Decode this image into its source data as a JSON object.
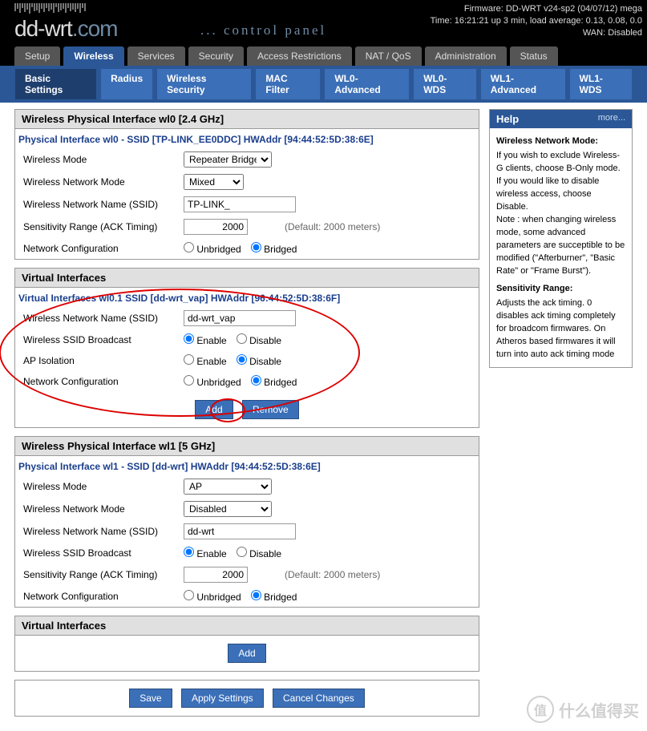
{
  "header": {
    "logo_main": "dd-wrt",
    "logo_suffix": ".com",
    "control_panel": "... control panel",
    "firmware": "Firmware: DD-WRT v24-sp2 (04/07/12) mega",
    "time": "Time: 16:21:21 up 3 min, load average: 0.13, 0.08, 0.0",
    "wan": "WAN: Disabled"
  },
  "tabs": [
    "Setup",
    "Wireless",
    "Services",
    "Security",
    "Access Restrictions",
    "NAT / QoS",
    "Administration",
    "Status"
  ],
  "active_tab": 1,
  "subtabs": [
    "Basic Settings",
    "Radius",
    "Wireless Security",
    "MAC Filter",
    "WL0-Advanced",
    "WL0-WDS",
    "WL1-Advanced",
    "WL1-WDS"
  ],
  "active_subtab": 0,
  "wl0": {
    "legend": "Wireless Physical Interface wl0 [2.4 GHz]",
    "title": "Physical Interface wl0 - SSID [TP-LINK_EE0DDC] HWAddr [94:44:52:5D:38:6E]",
    "labels": {
      "mode": "Wireless Mode",
      "netmode": "Wireless Network Mode",
      "ssid": "Wireless Network Name (SSID)",
      "sens": "Sensitivity Range (ACK Timing)",
      "netcfg": "Network Configuration"
    },
    "mode_val": "Repeater Bridge",
    "netmode_val": "Mixed",
    "ssid_val": "TP-LINK_",
    "sens_val": "2000",
    "sens_default": "(Default: 2000 meters)",
    "unbridged": "Unbridged",
    "bridged": "Bridged"
  },
  "vif0": {
    "legend": "Virtual Interfaces",
    "title": "Virtual Interfaces wl0.1 SSID [dd-wrt_vap] HWAddr [96:44:52:5D:38:6F]",
    "labels": {
      "ssid": "Wireless Network Name (SSID)",
      "broadcast": "Wireless SSID Broadcast",
      "apiso": "AP Isolation",
      "netcfg": "Network Configuration"
    },
    "ssid_val": "dd-wrt_vap",
    "enable": "Enable",
    "disable": "Disable",
    "unbridged": "Unbridged",
    "bridged": "Bridged",
    "btn_add": "Add",
    "btn_remove": "Remove"
  },
  "wl1": {
    "legend": "Wireless Physical Interface wl1 [5 GHz]",
    "title": "Physical Interface wl1 - SSID [dd-wrt] HWAddr [94:44:52:5D:38:6E]",
    "labels": {
      "mode": "Wireless Mode",
      "netmode": "Wireless Network Mode",
      "ssid": "Wireless Network Name (SSID)",
      "broadcast": "Wireless SSID Broadcast",
      "sens": "Sensitivity Range (ACK Timing)",
      "netcfg": "Network Configuration"
    },
    "mode_val": "AP",
    "netmode_val": "Disabled",
    "ssid_val": "dd-wrt",
    "enable": "Enable",
    "disable": "Disable",
    "sens_val": "2000",
    "sens_default": "(Default: 2000 meters)",
    "unbridged": "Unbridged",
    "bridged": "Bridged"
  },
  "vif1": {
    "legend": "Virtual Interfaces",
    "btn_add": "Add"
  },
  "footer": {
    "save": "Save",
    "apply": "Apply Settings",
    "cancel": "Cancel Changes"
  },
  "help": {
    "head": "Help",
    "more": "more...",
    "h1": "Wireless Network Mode:",
    "p1": "If you wish to exclude Wireless-G clients, choose B-Only mode. If you would like to disable wireless access, choose Disable.",
    "p1b": "Note : when changing wireless mode, some advanced parameters are succeptible to be modified (\"Afterburner\", \"Basic Rate\" or \"Frame Burst\").",
    "h2": "Sensitivity Range:",
    "p2": "Adjusts the ack timing. 0 disables ack timing completely for broadcom firmwares. On Atheros based firmwares it will turn into auto ack timing mode"
  },
  "watermark": {
    "icon": "值",
    "text": "什么值得买"
  }
}
